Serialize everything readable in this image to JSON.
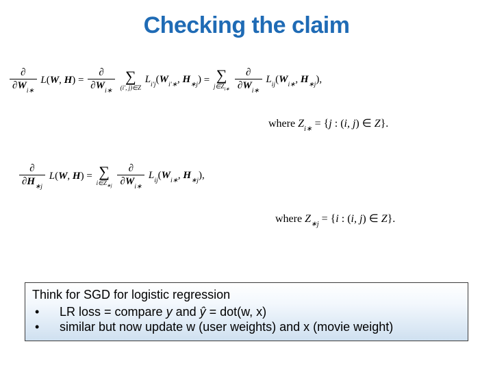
{
  "title": "Checking the claim",
  "equations": {
    "eq1_lhs_num": "∂",
    "eq1_lhs_den_prefix": "∂",
    "eq1_lhs_den_var": "W",
    "eq1_lhs_den_sub": "i∗",
    "eq1_L": "L",
    "eq1_args_open": "(",
    "eq1_W": "W",
    "eq1_comma": ", ",
    "eq1_H": "H",
    "eq1_args_close": ")",
    "eq": " = ",
    "sum1_below": "(i′, j)∈Z",
    "sigma": "∑",
    "eq1_mid_Lsub": "i′j",
    "eq1_mid_Wsub": "i′∗",
    "eq1_mid_Hsub": "∗j",
    "sum2_below": "j∈Z",
    "sum2_below_sub": "i∗",
    "eq1_rhs_Lsub": "ij",
    "eq1_rhs_Wsub": "i∗",
    "eq1_rhs_Hsub": "∗j",
    "trail_comma": ",",
    "where": "where ",
    "Z": "Z",
    "Zsub1": "i∗",
    "set1_open": " = {",
    "set1_var": "j",
    "set1_cond": " : (",
    "set1_i": "i, j",
    "set1_in": ") ∈ ",
    "set1_Z": "Z",
    "set1_close": "}.",
    "trail_period": "."
  },
  "equations2": {
    "lhs_den_var": "H",
    "lhs_den_sub": "∗j",
    "sum_below": "i∈Z",
    "sum_below_sub": "∗j",
    "rhs_frac_den_var": "W",
    "rhs_frac_den_sub": "i∗",
    "Lsub": "ij",
    "Wsub": "i∗",
    "Hsub": "∗j",
    "Zsub2": "∗j",
    "set2_var": "i",
    "set2_ij": "i, j"
  },
  "note": {
    "intro": "Think for SGD for logistic regression",
    "b1_prefix": "LR loss = compare ",
    "b1_y": "y",
    "b1_and": " and ",
    "b1_yhat": "ŷ",
    "b1_rest": " = dot(w, x)",
    "b2": "similar but now update w (user weights) and x (movie weight)",
    "bullet": "•"
  }
}
